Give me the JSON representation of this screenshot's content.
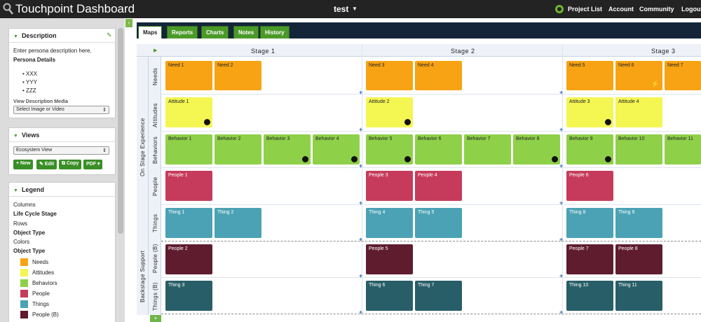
{
  "topbar": {
    "app_title": "Touchpoint Dashboard",
    "project_name": "test",
    "nav": [
      "Project List",
      "Account",
      "Community",
      "Logout"
    ]
  },
  "sidebar": {
    "collapse_icon": "chevron-left-icon",
    "description": {
      "title": "Description",
      "edit_icon": "pencil-icon",
      "text": "Enter persona description here.",
      "details_heading": "Persona Details",
      "bullets": [
        "XXX",
        "YYY",
        "ZZZ"
      ],
      "media_label": "View Description Media",
      "media_select": "Select Image or Video"
    },
    "views": {
      "title": "Views",
      "selected": "Ecosystem View",
      "buttons": [
        "+ New",
        "Edit",
        "Copy",
        "PDF"
      ]
    },
    "legend": {
      "title": "Legend",
      "columns_label": "Columns",
      "columns_value": "Life Cycle Stage",
      "rows_label": "Rows",
      "rows_value": "Object Type",
      "colors_label": "Colors",
      "colors_value": "Object Type",
      "items": [
        {
          "label": "Needs",
          "color": "#f7a313"
        },
        {
          "label": "Attitudes",
          "color": "#f4f652"
        },
        {
          "label": "Behaviors",
          "color": "#8fd049"
        },
        {
          "label": "People",
          "color": "#c63b5b"
        },
        {
          "label": "Things",
          "color": "#4aa2b4"
        },
        {
          "label": "People (B)",
          "color": "#5f1c2f"
        }
      ]
    }
  },
  "tabs": [
    "Maps",
    "Reports",
    "Charts",
    "Notes",
    "History"
  ],
  "active_tab": "Maps",
  "grid": {
    "stages": [
      "Stage 1",
      "Stage 2",
      "Stage 3"
    ],
    "groups": [
      "On Stage Experience",
      "Backstage Support"
    ],
    "rows": [
      "Needs",
      "Attitudes",
      "Behaviors",
      "People",
      "Things",
      "People (B)",
      "Things (B)"
    ],
    "cards": {
      "needs": [
        "Need 1",
        "Need 2",
        "Need 3",
        "Need 4",
        "Need 5",
        "Need 6",
        "Need 7"
      ],
      "attitudes": [
        "Attitude 1",
        "Attitude 2",
        "Attitude 3",
        "Attitude 4"
      ],
      "behaviors": [
        "Behavior 1",
        "Behavior 2",
        "Behavior 3",
        "Behavior 4",
        "Behavior 5",
        "Behavior 6",
        "Behavior 7",
        "Behavior 8",
        "Behavior 9",
        "Behavior 10",
        "Behavior 11"
      ],
      "people": [
        "People 1",
        "People 3",
        "People 4",
        "People 6"
      ],
      "things": [
        "Thing 1",
        "Thing 2",
        "Thing 4",
        "Thing 5",
        "Thing 8",
        "Thing 9"
      ],
      "people_b": [
        "People 2",
        "People 5",
        "People 7",
        "People 8"
      ],
      "things_b": [
        "Thing 3",
        "Thing 6",
        "Thing 7",
        "Thing 10",
        "Thing 11"
      ]
    }
  }
}
